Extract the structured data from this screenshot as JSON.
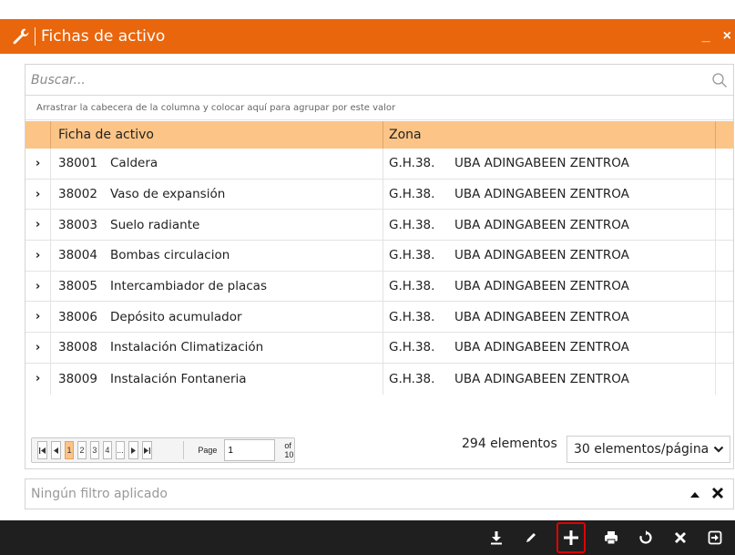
{
  "window": {
    "title": "Fichas de activo",
    "minimize_label": "_",
    "close_label": "×"
  },
  "search": {
    "placeholder": "Buscar..."
  },
  "group_hint": "Arrastrar la cabecera de la columna y colocar aquí para agrupar por este valor",
  "table": {
    "columns": [
      "Ficha de activo",
      "Zona"
    ],
    "rows": [
      {
        "code": "38001",
        "name": "Caldera",
        "zone": "G.H.38.",
        "zone_name": "UBA ADINGABEEN ZENTROA"
      },
      {
        "code": "38002",
        "name": "Vaso de expansión",
        "zone": "G.H.38.",
        "zone_name": "UBA ADINGABEEN ZENTROA"
      },
      {
        "code": "38003",
        "name": "Suelo radiante",
        "zone": "G.H.38.",
        "zone_name": "UBA ADINGABEEN ZENTROA"
      },
      {
        "code": "38004",
        "name": "Bombas circulacion",
        "zone": "G.H.38.",
        "zone_name": "UBA ADINGABEEN ZENTROA"
      },
      {
        "code": "38005",
        "name": "Intercambiador de placas",
        "zone": "G.H.38.",
        "zone_name": "UBA ADINGABEEN ZENTROA"
      },
      {
        "code": "38006",
        "name": "Depósito acumulador",
        "zone": "G.H.38.",
        "zone_name": "UBA ADINGABEEN ZENTROA"
      },
      {
        "code": "38008",
        "name": "Instalación Climatización",
        "zone": "G.H.38.",
        "zone_name": "UBA ADINGABEEN ZENTROA"
      },
      {
        "code": "38009",
        "name": "Instalación Fontaneria",
        "zone": "G.H.38.",
        "zone_name": "UBA ADINGABEEN ZENTROA"
      }
    ]
  },
  "pager": {
    "pages": [
      "1",
      "2",
      "3",
      "4",
      "..."
    ],
    "current_page": "1",
    "page_label": "Page",
    "of_label": "of 10",
    "elements_count": "294 elementos",
    "per_page": "30 elementos/página"
  },
  "filter": {
    "text": "Ningún filtro aplicado"
  },
  "toolbar": {
    "icons": [
      "download-icon",
      "edit-icon",
      "add-icon",
      "print-icon",
      "refresh-icon",
      "delete-icon",
      "exit-icon"
    ]
  },
  "colors": {
    "title_bar": "#e9660c",
    "header": "#fcc486",
    "toolbar": "#1f1f1f",
    "highlight": "#e10000"
  }
}
